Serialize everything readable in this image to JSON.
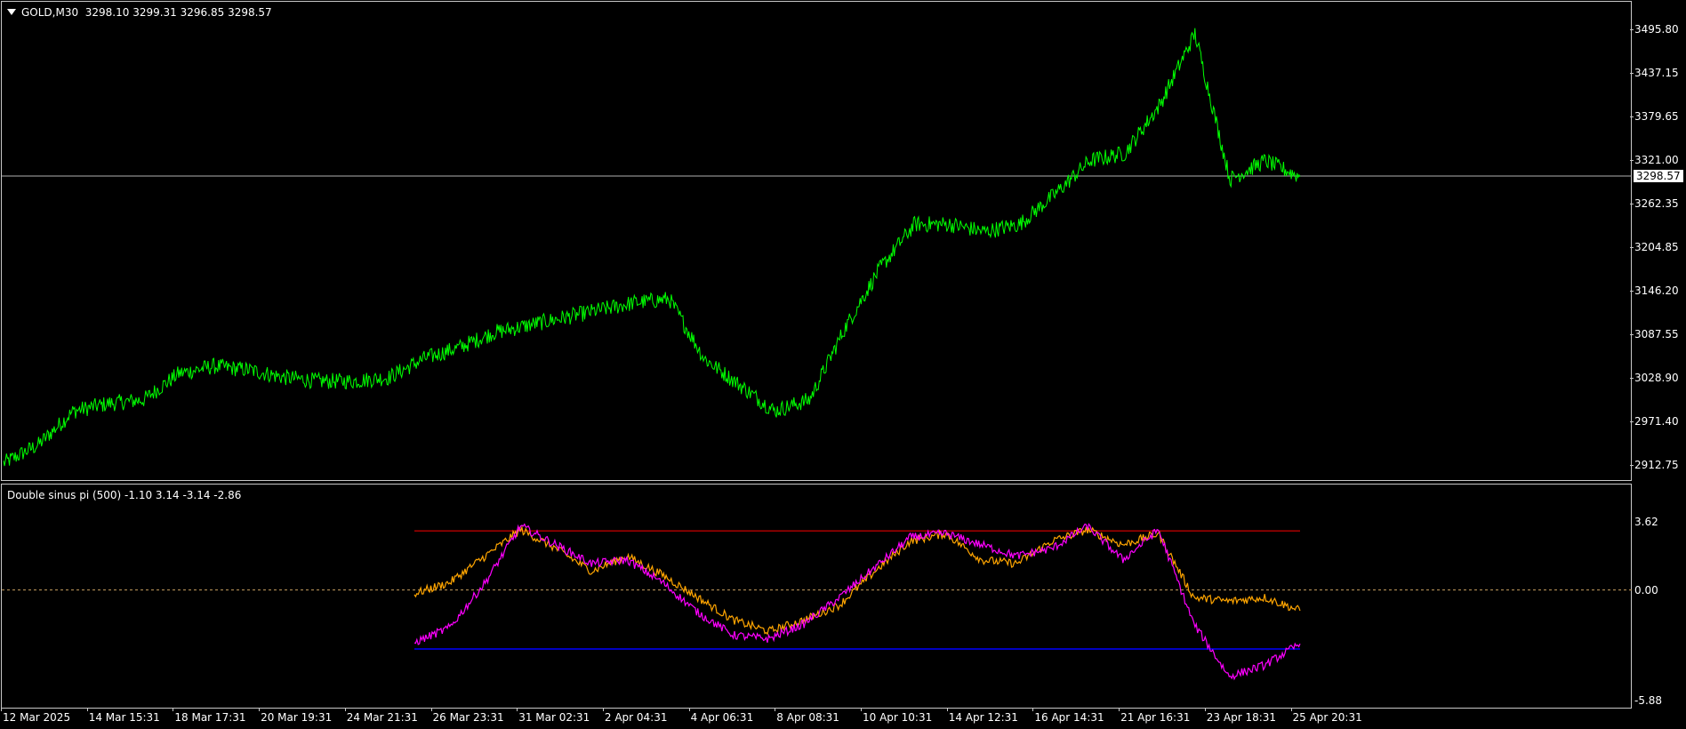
{
  "main_chart": {
    "header_icon": "dropdown-triangle-icon",
    "symbol": "GOLD,M30",
    "ohlc": "3298.10 3299.31 3296.85 3298.57",
    "current_price_label": "3298.57",
    "price_axis_labels": [
      "3495.80",
      "3437.15",
      "3379.65",
      "3321.00",
      "3262.35",
      "3204.85",
      "3146.20",
      "3087.55",
      "3028.90",
      "2971.40",
      "2912.75"
    ]
  },
  "indicator": {
    "header": "Double sinus pi (500) -1.10 3.14 -3.14 -2.86",
    "axis_labels": [
      "3.62",
      "0.00",
      "-5.88"
    ]
  },
  "time_axis_labels": [
    "12 Mar 2025",
    "14 Mar 15:31",
    "18 Mar 17:31",
    "20 Mar 19:31",
    "24 Mar 21:31",
    "26 Mar 23:31",
    "31 Mar 02:31",
    "2 Apr 04:31",
    "4 Apr 06:31",
    "8 Apr 08:31",
    "10 Apr 10:31",
    "14 Apr 12:31",
    "16 Apr 14:31",
    "21 Apr 16:31",
    "23 Apr 18:31",
    "25 Apr 20:31"
  ],
  "colors": {
    "price_line": "#00ff00",
    "indicator_line_1": "#ffa500",
    "indicator_line_2": "#ff00ff",
    "upper_level": "#ff0000",
    "lower_level": "#0000ff",
    "zero_line": "#c8a060",
    "grid_border": "#c8c8c8"
  },
  "chart_data": [
    {
      "type": "line",
      "title": "GOLD,M30",
      "ylim": [
        2890,
        3520
      ],
      "series": [
        {
          "name": "GOLD",
          "x": [
            "12 Mar",
            "13 Mar",
            "14 Mar",
            "15 Mar",
            "17 Mar",
            "18 Mar",
            "19 Mar",
            "20 Mar",
            "21 Mar",
            "23 Mar",
            "24 Mar",
            "25 Mar",
            "26 Mar",
            "27 Mar",
            "28 Mar",
            "29 Mar",
            "31 Mar",
            "1 Apr",
            "2 Apr",
            "3 Apr",
            "4 Apr",
            "5 Apr",
            "7 Apr",
            "8 Apr",
            "9 Apr",
            "10 Apr",
            "11 Apr",
            "12 Apr",
            "14 Apr",
            "15 Apr",
            "16 Apr",
            "17 Apr",
            "18 Apr",
            "21 Apr",
            "22 Apr",
            "23 Apr",
            "24 Apr",
            "25 Apr"
          ],
          "values": [
            2915,
            2940,
            2985,
            2995,
            3000,
            3035,
            3045,
            3040,
            3030,
            3025,
            3025,
            3030,
            3055,
            3070,
            3090,
            3100,
            3110,
            3120,
            3130,
            3135,
            3055,
            3020,
            2985,
            3000,
            3095,
            3175,
            3235,
            3235,
            3225,
            3235,
            3275,
            3320,
            3330,
            3395,
            3490,
            3295,
            3320,
            3298.57
          ]
        }
      ]
    },
    {
      "type": "line",
      "title": "Double sinus pi (500)",
      "ylim": [
        -5.88,
        3.62
      ],
      "series": [
        {
          "name": "line 1",
          "x": [
            "26 Mar",
            "27 Mar",
            "28 Mar",
            "29 Mar",
            "31 Mar",
            "1 Apr",
            "2 Apr",
            "3 Apr",
            "4 Apr",
            "5 Apr",
            "7 Apr",
            "8 Apr",
            "9 Apr",
            "10 Apr",
            "11 Apr",
            "12 Apr",
            "14 Apr",
            "15 Apr",
            "16 Apr",
            "17 Apr",
            "18 Apr",
            "21 Apr",
            "22 Apr",
            "23 Apr",
            "24 Apr",
            "25 Apr"
          ],
          "values": [
            -0.2,
            0.4,
            1.8,
            3.2,
            2.2,
            1.0,
            1.8,
            0.8,
            -0.4,
            -1.6,
            -2.2,
            -1.6,
            -0.8,
            1.0,
            2.6,
            3.0,
            1.6,
            1.4,
            2.6,
            3.2,
            2.4,
            3.0,
            -0.4,
            -0.6,
            -0.4,
            -1.1
          ]
        },
        {
          "name": "line 2",
          "x": [
            "26 Mar",
            "27 Mar",
            "28 Mar",
            "29 Mar",
            "31 Mar",
            "1 Apr",
            "2 Apr",
            "3 Apr",
            "4 Apr",
            "5 Apr",
            "7 Apr",
            "8 Apr",
            "9 Apr",
            "10 Apr",
            "11 Apr",
            "12 Apr",
            "14 Apr",
            "15 Apr",
            "16 Apr",
            "17 Apr",
            "18 Apr",
            "21 Apr",
            "22 Apr",
            "23 Apr",
            "24 Apr",
            "25 Apr"
          ],
          "values": [
            -2.8,
            -2.0,
            0.4,
            3.4,
            2.4,
            1.4,
            1.6,
            0.4,
            -1.2,
            -2.4,
            -2.6,
            -1.8,
            -0.4,
            1.2,
            2.8,
            3.0,
            2.4,
            1.8,
            2.2,
            3.4,
            1.6,
            3.2,
            -1.8,
            -4.6,
            -4.0,
            -2.86
          ]
        }
      ],
      "levels": [
        3.14,
        0.0,
        -3.14
      ]
    }
  ]
}
